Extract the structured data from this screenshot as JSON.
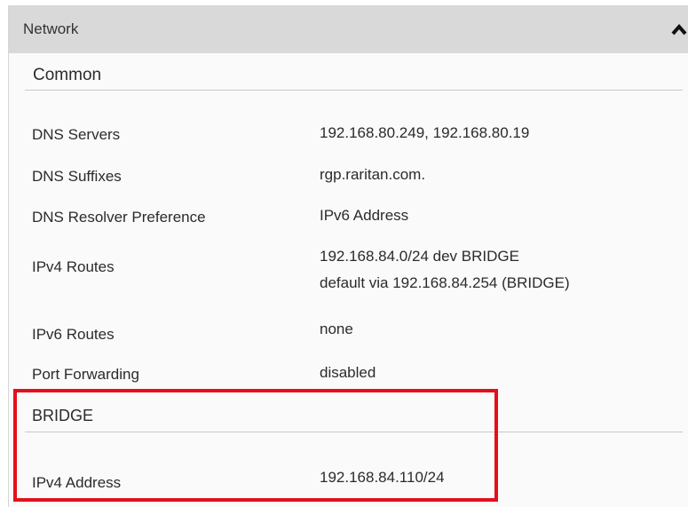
{
  "panel": {
    "title": "Network",
    "collapse_icon": "chevron-up-icon"
  },
  "sections": {
    "common": {
      "title": "Common",
      "rows": {
        "dns_servers": {
          "label": "DNS Servers",
          "value": "192.168.80.249, 192.168.80.19"
        },
        "dns_suffixes": {
          "label": "DNS Suffixes",
          "value": "rgp.raritan.com."
        },
        "dns_resolver": {
          "label": "DNS Resolver Preference",
          "value": "IPv6 Address"
        },
        "ipv4_routes": {
          "label": "IPv4 Routes",
          "value_line1": "192.168.84.0/24 dev BRIDGE",
          "value_line2": "default via 192.168.84.254 (BRIDGE)"
        },
        "ipv6_routes": {
          "label": "IPv6 Routes",
          "value": "none"
        },
        "port_forwarding": {
          "label": "Port Forwarding",
          "value": "disabled"
        }
      }
    },
    "bridge": {
      "title": "BRIDGE",
      "rows": {
        "ipv4_address": {
          "label": "IPv4 Address",
          "value": "192.168.84.110/24"
        }
      }
    }
  },
  "colors": {
    "header_bg": "#d9d9d9",
    "panel_bg": "#fafafa",
    "highlight": "#e3101b"
  }
}
